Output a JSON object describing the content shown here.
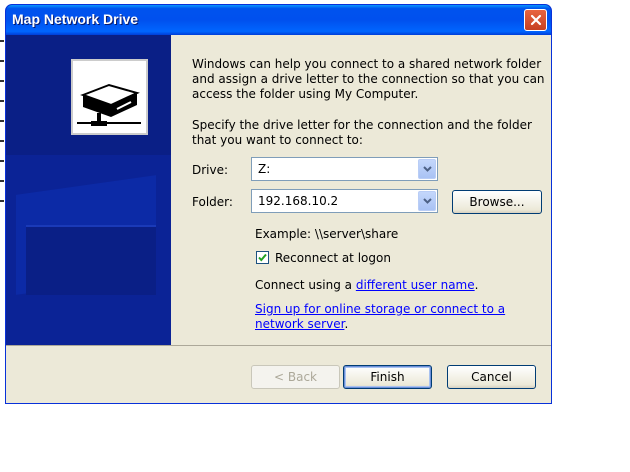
{
  "window": {
    "title": "Map Network Drive"
  },
  "content": {
    "intro": "Windows can help you connect to a shared network folder and assign a drive letter to the connection so that you can access the folder using My Computer.",
    "instructions": "Specify the drive letter for the connection and the folder that you want to connect to:",
    "drive_label": "Drive:",
    "drive_value": "Z:",
    "folder_label": "Folder:",
    "folder_value": "192.168.10.2",
    "browse_label": "Browse...",
    "example_text": "Example: \\\\server\\share",
    "reconnect_label": "Reconnect at logon",
    "reconnect_checked": true,
    "connect_prefix": "Connect using a ",
    "connect_link": "different user name",
    "connect_suffix": ".",
    "signup_link_line1": "Sign up for online storage or connect to a",
    "signup_link_line2": "network server",
    "signup_suffix": "."
  },
  "footer": {
    "back_label": "< Back",
    "finish_label": "Finish",
    "cancel_label": "Cancel"
  },
  "icons": {
    "close": "close-icon",
    "dropdown": "chevron-down-icon",
    "logo": "network-drive-icon",
    "check": "checkmark-icon"
  },
  "colors": {
    "titlebar": "#0053ee",
    "left_panel": "#0a1f86",
    "dialog_bg": "#ece9d8",
    "link": "#0000ff",
    "checkmark": "#21a121"
  }
}
